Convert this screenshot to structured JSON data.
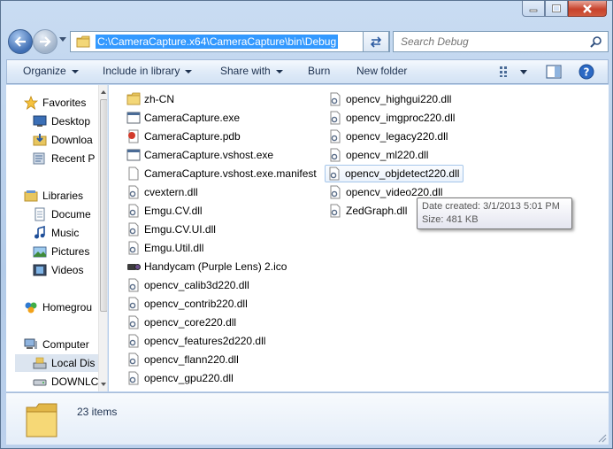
{
  "window": {
    "buttons": {
      "minimize": "minimize",
      "maximize": "maximize",
      "close": "close"
    }
  },
  "address": {
    "path": "C:\\CameraCapture.x64\\CameraCapture\\bin\\Debug",
    "search_placeholder": "Search Debug"
  },
  "toolbar": {
    "organize": "Organize",
    "include_in_library": "Include in library",
    "share_with": "Share with",
    "burn": "Burn",
    "new_folder": "New folder"
  },
  "nav": {
    "items": [
      {
        "label": "Favorites",
        "icon": "star-icon"
      },
      {
        "label": "Desktop",
        "icon": "desktop-icon"
      },
      {
        "label": "Downloa",
        "icon": "downloads-icon"
      },
      {
        "label": "Recent P",
        "icon": "recent-places-icon"
      },
      {
        "label": "Libraries",
        "icon": "libraries-icon"
      },
      {
        "label": "Docume",
        "icon": "documents-icon"
      },
      {
        "label": "Music",
        "icon": "music-icon"
      },
      {
        "label": "Pictures",
        "icon": "pictures-icon"
      },
      {
        "label": "Videos",
        "icon": "videos-icon"
      },
      {
        "label": "Homegrou",
        "icon": "homegroup-icon"
      },
      {
        "label": "Computer",
        "icon": "computer-icon"
      },
      {
        "label": "Local Dis",
        "icon": "local-disk-icon"
      },
      {
        "label": "DOWNLC",
        "icon": "drive-icon"
      }
    ]
  },
  "files": {
    "col1": [
      {
        "name": "zh-CN",
        "icon": "folder-icon"
      },
      {
        "name": "CameraCapture.exe",
        "icon": "exe-icon"
      },
      {
        "name": "CameraCapture.pdb",
        "icon": "pdb-icon"
      },
      {
        "name": "CameraCapture.vshost.exe",
        "icon": "exe-icon"
      },
      {
        "name": "CameraCapture.vshost.exe.manifest",
        "icon": "file-icon"
      },
      {
        "name": "cvextern.dll",
        "icon": "dll-icon"
      },
      {
        "name": "Emgu.CV.dll",
        "icon": "dll-icon"
      },
      {
        "name": "Emgu.CV.UI.dll",
        "icon": "dll-icon"
      },
      {
        "name": "Emgu.Util.dll",
        "icon": "dll-icon"
      },
      {
        "name": "Handycam (Purple Lens) 2.ico",
        "icon": "camera-icon"
      },
      {
        "name": "opencv_calib3d220.dll",
        "icon": "dll-icon"
      },
      {
        "name": "opencv_contrib220.dll",
        "icon": "dll-icon"
      },
      {
        "name": "opencv_core220.dll",
        "icon": "dll-icon"
      },
      {
        "name": "opencv_features2d220.dll",
        "icon": "dll-icon"
      },
      {
        "name": "opencv_flann220.dll",
        "icon": "dll-icon"
      },
      {
        "name": "opencv_gpu220.dll",
        "icon": "dll-icon"
      }
    ],
    "col2": [
      {
        "name": "opencv_highgui220.dll",
        "icon": "dll-icon"
      },
      {
        "name": "opencv_imgproc220.dll",
        "icon": "dll-icon"
      },
      {
        "name": "opencv_legacy220.dll",
        "icon": "dll-icon"
      },
      {
        "name": "opencv_ml220.dll",
        "icon": "dll-icon"
      },
      {
        "name": "opencv_objdetect220.dll",
        "icon": "dll-icon"
      },
      {
        "name": "opencv_video220.dll",
        "icon": "dll-icon"
      },
      {
        "name": "ZedGraph.dll",
        "icon": "dll-icon"
      }
    ]
  },
  "tooltip": {
    "date": "Date created: 3/1/2013 5:01 PM",
    "size": "Size: 481 KB"
  },
  "details": {
    "count": "23 items"
  },
  "colors": {
    "selection": "#3399ff",
    "hover_border": "#a5c6ea",
    "frame": "#b3cbe8"
  }
}
